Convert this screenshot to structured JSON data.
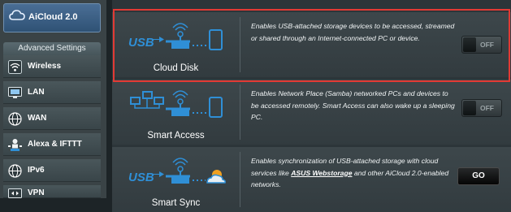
{
  "sidebar": {
    "top_item": {
      "label": "AiCloud 2.0",
      "icon": "cloud-icon"
    },
    "section_header": "Advanced Settings",
    "items": [
      {
        "label": "Wireless",
        "icon": "wifi-icon"
      },
      {
        "label": "LAN",
        "icon": "lan-icon"
      },
      {
        "label": "WAN",
        "icon": "globe-icon"
      },
      {
        "label": "Alexa & IFTTT",
        "icon": "alexa-icon"
      },
      {
        "label": "IPv6",
        "icon": "ipv6-globe-icon"
      },
      {
        "label": "VPN",
        "icon": "vpn-icon"
      }
    ]
  },
  "features": [
    {
      "name": "Cloud Disk",
      "icon": "usb-router-device-icon",
      "description": "Enables USB-attached storage devices to be accessed, streamed or shared through an Internet-connected PC or device.",
      "toggle_label": "OFF"
    },
    {
      "name": "Smart Access",
      "icon": "network-router-device-icon",
      "description": "Enables Network Place (Samba) networked PCs and devices to be accessed remotely. Smart Access can also wake up a sleeping PC.",
      "toggle_label": "OFF"
    },
    {
      "name": "Smart Sync",
      "icon": "usb-router-cloud-icon",
      "description_before": "Enables synchronization of USB-attached storage with cloud services like ",
      "description_link": "ASUS Webstorage",
      "description_after": " and other AiCloud 2.0-enabled networks.",
      "button_label": "GO"
    }
  ],
  "colors": {
    "highlight_border": "#e23a34",
    "icon_blue": "#2f8fd6",
    "sidebar_active": "#3f6590"
  }
}
